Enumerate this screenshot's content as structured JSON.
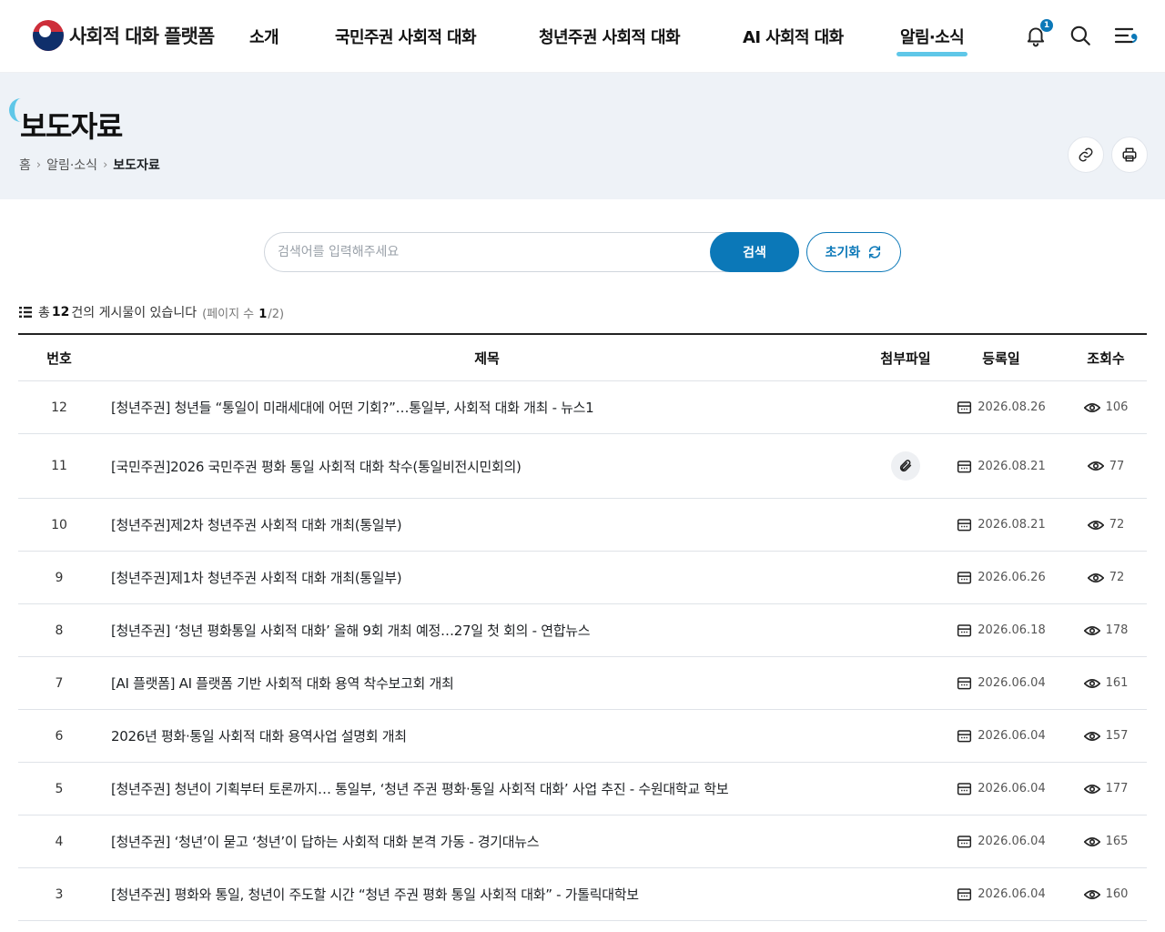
{
  "header": {
    "logo_text": "사회적 대화 플랫폼",
    "nav": [
      "소개",
      "국민주권 사회적 대화",
      "청년주권 사회적 대화",
      "AI 사회적 대화",
      "알림·소식"
    ],
    "notification_count": "1"
  },
  "page": {
    "title": "보도자료",
    "breadcrumb": [
      "홈",
      "알림·소식",
      "보도자료"
    ]
  },
  "search": {
    "placeholder": "검색어를 입력해주세요",
    "value": "",
    "button_label": "검색",
    "reset_label": "초기화"
  },
  "summary": {
    "prefix": "총",
    "total": "12",
    "suffix": "건의 게시물이 있습니다",
    "page_label": "(페이지 수",
    "current_page": "1",
    "total_pages": "/2)"
  },
  "table": {
    "headers": [
      "번호",
      "제목",
      "첨부파일",
      "등록일",
      "조회수"
    ],
    "rows": [
      {
        "no": "12",
        "title": "[청년주권] 청년들 “통일이 미래세대에 어떤 기회?”…통일부, 사회적 대화 개최 - 뉴스1",
        "attachment": false,
        "date": "2026.08.26",
        "views": "106"
      },
      {
        "no": "11",
        "title": "[국민주권]2026 국민주권 평화 통일 사회적 대화 착수(통일비전시민회의)",
        "attachment": true,
        "date": "2026.08.21",
        "views": "77"
      },
      {
        "no": "10",
        "title": "[청년주권]제2차 청년주권 사회적 대화 개최(통일부)",
        "attachment": false,
        "date": "2026.08.21",
        "views": "72"
      },
      {
        "no": "9",
        "title": "[청년주권]제1차 청년주권 사회적 대화 개최(통일부)",
        "attachment": false,
        "date": "2026.06.26",
        "views": "72"
      },
      {
        "no": "8",
        "title": "[청년주권] ‘청년 평화통일 사회적 대화’ 올해 9회 개최 예정…27일 첫 회의 - 연합뉴스",
        "attachment": false,
        "date": "2026.06.18",
        "views": "178"
      },
      {
        "no": "7",
        "title": "[AI 플랫폼] AI 플랫폼 기반 사회적 대화 용역 착수보고회 개최",
        "attachment": false,
        "date": "2026.06.04",
        "views": "161"
      },
      {
        "no": "6",
        "title": "2026년 평화·통일 사회적 대화 용역사업 설명회 개최",
        "attachment": false,
        "date": "2026.06.04",
        "views": "157"
      },
      {
        "no": "5",
        "title": "[청년주권] 청년이 기획부터 토론까지… 통일부, ‘청년 주권 평화·통일 사회적 대화’ 사업 추진 - 수원대학교 학보",
        "attachment": false,
        "date": "2026.06.04",
        "views": "177"
      },
      {
        "no": "4",
        "title": "[청년주권] ‘청년’이 묻고 ‘청년’이 답하는 사회적 대화 본격 가동 - 경기대뉴스",
        "attachment": false,
        "date": "2026.06.04",
        "views": "165"
      },
      {
        "no": "3",
        "title": "[청년주권] 평화와 통일, 청년이 주도할 시간 “청년 주권 평화 통일 사회적 대화” - 가톨릭대학보",
        "attachment": false,
        "date": "2026.06.04",
        "views": "160"
      }
    ]
  },
  "colors": {
    "primary": "#0b78b8",
    "accent": "#5fc7e8",
    "band": "#eef2f7"
  },
  "icons": [
    "bell-icon",
    "search-icon",
    "menu-icon",
    "link-icon",
    "print-icon",
    "list-icon",
    "refresh-icon",
    "calendar-icon",
    "eye-icon",
    "paperclip-icon"
  ]
}
